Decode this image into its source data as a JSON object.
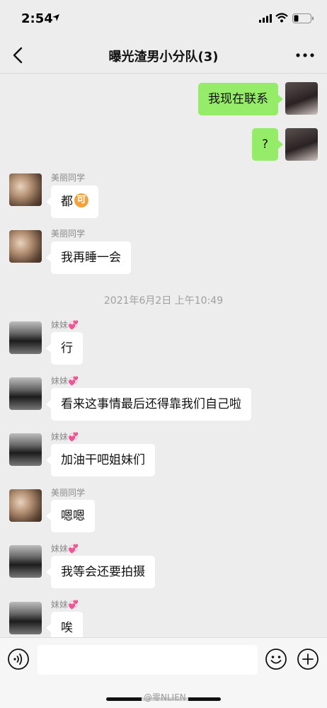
{
  "status_bar": {
    "time": "2:54"
  },
  "nav": {
    "title": "曝光渣男小分队(3)"
  },
  "timestamp": "2021年6月2日 上午10:49",
  "messages": [
    {
      "sender": "self",
      "name": "",
      "text": "我现在联系"
    },
    {
      "sender": "self",
      "name": "",
      "text": "?"
    },
    {
      "sender": "meili",
      "name": "美丽同学",
      "text": "都",
      "emoji": "可"
    },
    {
      "sender": "meili",
      "name": "美丽同学",
      "text": "我再睡一会"
    },
    {
      "sender": "meimei",
      "name": "妹妹💞",
      "text": "行"
    },
    {
      "sender": "meimei",
      "name": "妹妹💞",
      "text": "看来这事情最后还得靠我们自己啦"
    },
    {
      "sender": "meimei",
      "name": "妹妹💞",
      "text": "加油干吧姐妹们"
    },
    {
      "sender": "meili",
      "name": "美丽同学",
      "text": "嗯嗯"
    },
    {
      "sender": "meimei",
      "name": "妹妹💞",
      "text": "我等会还要拍摄"
    },
    {
      "sender": "meimei",
      "name": "妹妹💞",
      "text": "唉"
    }
  ],
  "input": {
    "value": ""
  },
  "icons": {
    "back": "chevron-left-icon",
    "more": "ellipsis-icon",
    "voice": "voice-icon",
    "emoji": "smiley-icon",
    "plus": "plus-icon"
  },
  "colors": {
    "bubble_self": "#95ec69",
    "bubble_other": "#ffffff",
    "background": "#ededed"
  },
  "watermark": "@零NLIEN"
}
